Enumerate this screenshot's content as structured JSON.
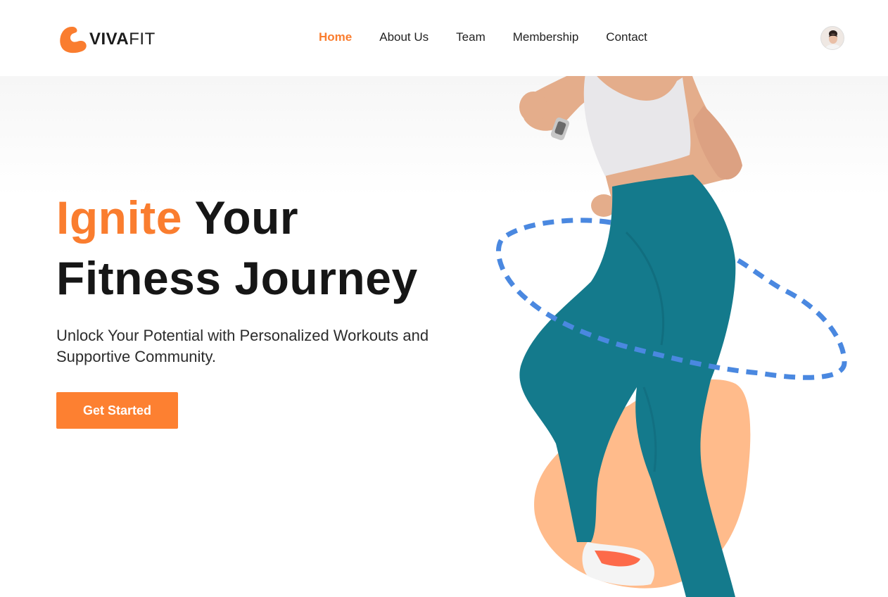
{
  "brand": {
    "name_part1": "VIVA",
    "name_part2": "FIT",
    "accent_color": "#fa7d2f"
  },
  "nav": {
    "items": [
      {
        "label": "Home",
        "active": true
      },
      {
        "label": "About Us",
        "active": false
      },
      {
        "label": "Team",
        "active": false
      },
      {
        "label": "Membership",
        "active": false
      },
      {
        "label": "Contact",
        "active": false
      }
    ]
  },
  "profile": {
    "icon": "user-avatar"
  },
  "hero": {
    "title_accent": "Ignite",
    "title_rest_line1": "Your",
    "title_line2": "Fitness Journey",
    "subtitle": "Unlock Your Potential with Personalized Workouts and Supportive Community.",
    "cta_label": "Get Started",
    "colors": {
      "blob": "#ffbb8b",
      "dashed_ring": "#4a88e0",
      "leggings": "#147a8c",
      "top": "#e8e7ea",
      "skin": "#e4ad8b"
    }
  }
}
